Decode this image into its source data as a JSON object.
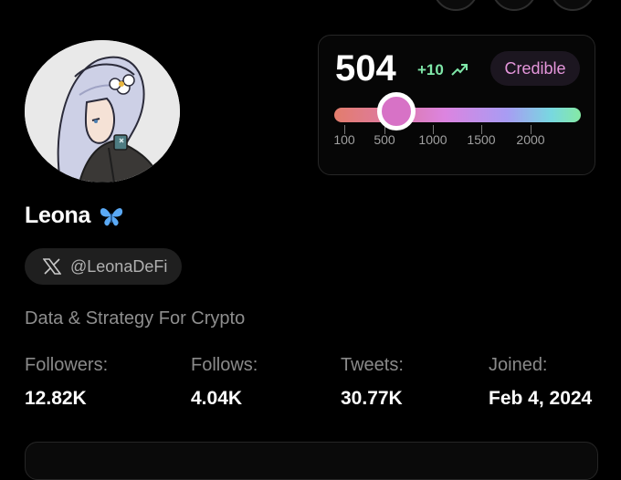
{
  "profile": {
    "name": "Leona",
    "name_emoji_icon": "butterfly-icon",
    "x_icon": "x-logo-icon",
    "handle": "@LeonaDeFi",
    "bio": "Data & Strategy For Crypto"
  },
  "stats": [
    {
      "label": "Followers:",
      "value": "12.82K"
    },
    {
      "label": "Follows:",
      "value": "4.04K"
    },
    {
      "label": "Tweets:",
      "value": "30.77K"
    },
    {
      "label": "Joined:",
      "value": "Feb 4, 2024"
    }
  ],
  "score": {
    "value": "504",
    "delta": "+10",
    "trend_icon": "trend-up-icon",
    "badge": "Credible",
    "scale_labels": [
      "100",
      "500",
      "1000",
      "1500",
      "2000"
    ],
    "colors": {
      "delta": "#7fe6a8",
      "badge_text": "#e596db",
      "thumb": "#d772c6"
    }
  }
}
